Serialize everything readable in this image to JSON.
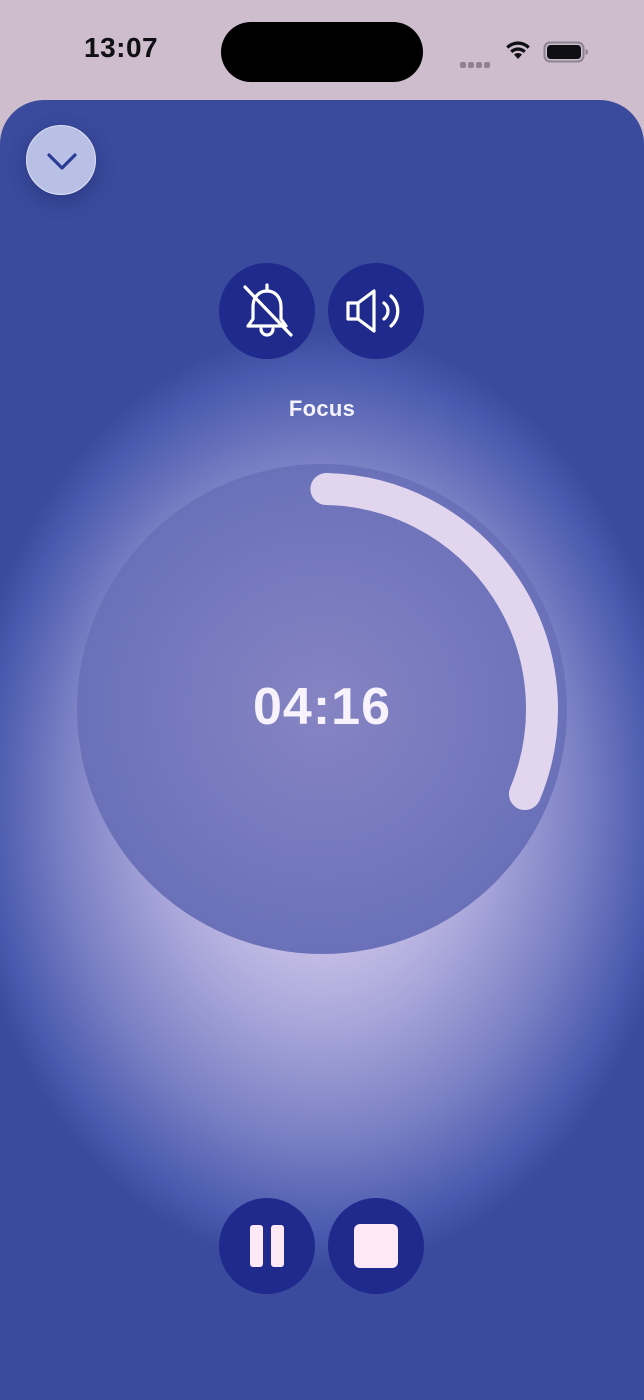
{
  "status_bar": {
    "time": "13:07",
    "icons": [
      "signal-dots-icon",
      "wifi-icon",
      "battery-icon"
    ]
  },
  "sheet": {
    "dismiss_icon": "chevron-down-icon",
    "alerts_icon": "bell-slash-icon",
    "sound_icon": "speaker-wave-icon",
    "session_label": "Focus",
    "timer": {
      "remaining": "04:16",
      "progress_fraction": 0.31
    },
    "controls": {
      "pause_icon": "pause-icon",
      "stop_icon": "stop-icon"
    }
  },
  "colors": {
    "accent_button": "#1f2a8c",
    "progress_ring": "#e2d5ee",
    "dial_fill": "#7077bd"
  }
}
